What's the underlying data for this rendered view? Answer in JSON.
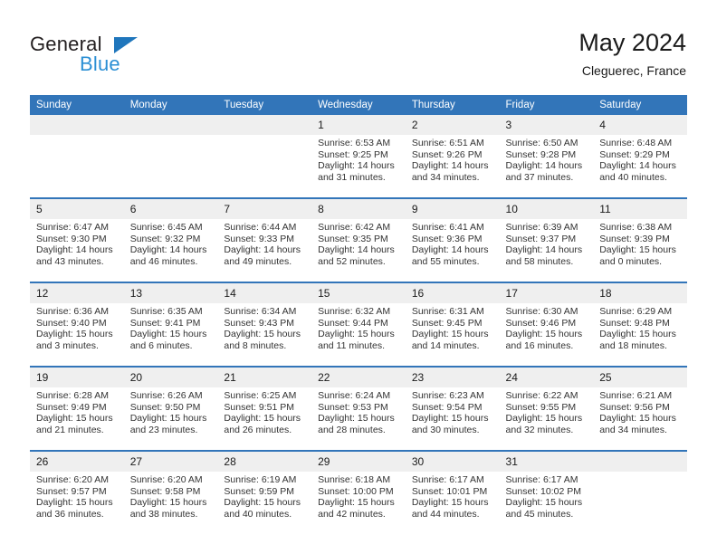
{
  "brand": {
    "name_part1": "General",
    "name_part2": "Blue",
    "triangle_color": "#1f76bc",
    "blue_color": "#2b8fd4"
  },
  "header": {
    "title": "May 2024",
    "subtitle": "Cleguerec, France",
    "header_bg": "#3275b9",
    "daynum_bg": "#efefef"
  },
  "weekday_headers": [
    "Sunday",
    "Monday",
    "Tuesday",
    "Wednesday",
    "Thursday",
    "Friday",
    "Saturday"
  ],
  "weeks": [
    {
      "days": [
        {
          "num": "",
          "lines": [
            "",
            "",
            "",
            ""
          ]
        },
        {
          "num": "",
          "lines": [
            "",
            "",
            "",
            ""
          ]
        },
        {
          "num": "",
          "lines": [
            "",
            "",
            "",
            ""
          ]
        },
        {
          "num": "1",
          "lines": [
            "Sunrise: 6:53 AM",
            "Sunset: 9:25 PM",
            "Daylight: 14 hours",
            "and 31 minutes."
          ]
        },
        {
          "num": "2",
          "lines": [
            "Sunrise: 6:51 AM",
            "Sunset: 9:26 PM",
            "Daylight: 14 hours",
            "and 34 minutes."
          ]
        },
        {
          "num": "3",
          "lines": [
            "Sunrise: 6:50 AM",
            "Sunset: 9:28 PM",
            "Daylight: 14 hours",
            "and 37 minutes."
          ]
        },
        {
          "num": "4",
          "lines": [
            "Sunrise: 6:48 AM",
            "Sunset: 9:29 PM",
            "Daylight: 14 hours",
            "and 40 minutes."
          ]
        }
      ]
    },
    {
      "days": [
        {
          "num": "5",
          "lines": [
            "Sunrise: 6:47 AM",
            "Sunset: 9:30 PM",
            "Daylight: 14 hours",
            "and 43 minutes."
          ]
        },
        {
          "num": "6",
          "lines": [
            "Sunrise: 6:45 AM",
            "Sunset: 9:32 PM",
            "Daylight: 14 hours",
            "and 46 minutes."
          ]
        },
        {
          "num": "7",
          "lines": [
            "Sunrise: 6:44 AM",
            "Sunset: 9:33 PM",
            "Daylight: 14 hours",
            "and 49 minutes."
          ]
        },
        {
          "num": "8",
          "lines": [
            "Sunrise: 6:42 AM",
            "Sunset: 9:35 PM",
            "Daylight: 14 hours",
            "and 52 minutes."
          ]
        },
        {
          "num": "9",
          "lines": [
            "Sunrise: 6:41 AM",
            "Sunset: 9:36 PM",
            "Daylight: 14 hours",
            "and 55 minutes."
          ]
        },
        {
          "num": "10",
          "lines": [
            "Sunrise: 6:39 AM",
            "Sunset: 9:37 PM",
            "Daylight: 14 hours",
            "and 58 minutes."
          ]
        },
        {
          "num": "11",
          "lines": [
            "Sunrise: 6:38 AM",
            "Sunset: 9:39 PM",
            "Daylight: 15 hours",
            "and 0 minutes."
          ]
        }
      ]
    },
    {
      "days": [
        {
          "num": "12",
          "lines": [
            "Sunrise: 6:36 AM",
            "Sunset: 9:40 PM",
            "Daylight: 15 hours",
            "and 3 minutes."
          ]
        },
        {
          "num": "13",
          "lines": [
            "Sunrise: 6:35 AM",
            "Sunset: 9:41 PM",
            "Daylight: 15 hours",
            "and 6 minutes."
          ]
        },
        {
          "num": "14",
          "lines": [
            "Sunrise: 6:34 AM",
            "Sunset: 9:43 PM",
            "Daylight: 15 hours",
            "and 8 minutes."
          ]
        },
        {
          "num": "15",
          "lines": [
            "Sunrise: 6:32 AM",
            "Sunset: 9:44 PM",
            "Daylight: 15 hours",
            "and 11 minutes."
          ]
        },
        {
          "num": "16",
          "lines": [
            "Sunrise: 6:31 AM",
            "Sunset: 9:45 PM",
            "Daylight: 15 hours",
            "and 14 minutes."
          ]
        },
        {
          "num": "17",
          "lines": [
            "Sunrise: 6:30 AM",
            "Sunset: 9:46 PM",
            "Daylight: 15 hours",
            "and 16 minutes."
          ]
        },
        {
          "num": "18",
          "lines": [
            "Sunrise: 6:29 AM",
            "Sunset: 9:48 PM",
            "Daylight: 15 hours",
            "and 18 minutes."
          ]
        }
      ]
    },
    {
      "days": [
        {
          "num": "19",
          "lines": [
            "Sunrise: 6:28 AM",
            "Sunset: 9:49 PM",
            "Daylight: 15 hours",
            "and 21 minutes."
          ]
        },
        {
          "num": "20",
          "lines": [
            "Sunrise: 6:26 AM",
            "Sunset: 9:50 PM",
            "Daylight: 15 hours",
            "and 23 minutes."
          ]
        },
        {
          "num": "21",
          "lines": [
            "Sunrise: 6:25 AM",
            "Sunset: 9:51 PM",
            "Daylight: 15 hours",
            "and 26 minutes."
          ]
        },
        {
          "num": "22",
          "lines": [
            "Sunrise: 6:24 AM",
            "Sunset: 9:53 PM",
            "Daylight: 15 hours",
            "and 28 minutes."
          ]
        },
        {
          "num": "23",
          "lines": [
            "Sunrise: 6:23 AM",
            "Sunset: 9:54 PM",
            "Daylight: 15 hours",
            "and 30 minutes."
          ]
        },
        {
          "num": "24",
          "lines": [
            "Sunrise: 6:22 AM",
            "Sunset: 9:55 PM",
            "Daylight: 15 hours",
            "and 32 minutes."
          ]
        },
        {
          "num": "25",
          "lines": [
            "Sunrise: 6:21 AM",
            "Sunset: 9:56 PM",
            "Daylight: 15 hours",
            "and 34 minutes."
          ]
        }
      ]
    },
    {
      "days": [
        {
          "num": "26",
          "lines": [
            "Sunrise: 6:20 AM",
            "Sunset: 9:57 PM",
            "Daylight: 15 hours",
            "and 36 minutes."
          ]
        },
        {
          "num": "27",
          "lines": [
            "Sunrise: 6:20 AM",
            "Sunset: 9:58 PM",
            "Daylight: 15 hours",
            "and 38 minutes."
          ]
        },
        {
          "num": "28",
          "lines": [
            "Sunrise: 6:19 AM",
            "Sunset: 9:59 PM",
            "Daylight: 15 hours",
            "and 40 minutes."
          ]
        },
        {
          "num": "29",
          "lines": [
            "Sunrise: 6:18 AM",
            "Sunset: 10:00 PM",
            "Daylight: 15 hours",
            "and 42 minutes."
          ]
        },
        {
          "num": "30",
          "lines": [
            "Sunrise: 6:17 AM",
            "Sunset: 10:01 PM",
            "Daylight: 15 hours",
            "and 44 minutes."
          ]
        },
        {
          "num": "31",
          "lines": [
            "Sunrise: 6:17 AM",
            "Sunset: 10:02 PM",
            "Daylight: 15 hours",
            "and 45 minutes."
          ]
        },
        {
          "num": "",
          "lines": [
            "",
            "",
            "",
            ""
          ]
        }
      ]
    }
  ]
}
